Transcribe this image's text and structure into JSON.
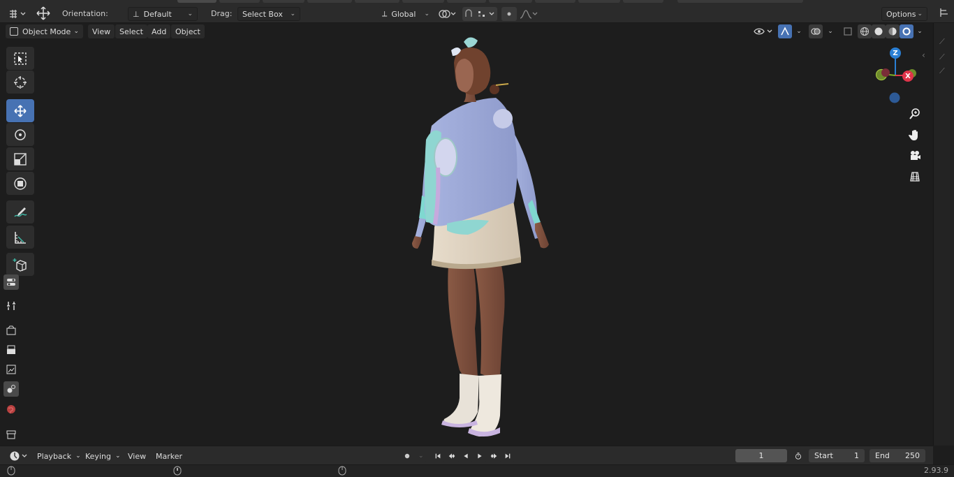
{
  "top": {
    "orientation_label": "Orientation:",
    "orientation_value": "Default",
    "drag_label": "Drag:",
    "drag_value": "Select Box",
    "transform_space": "Global",
    "options_label": "Options"
  },
  "header": {
    "mode": "Object Mode",
    "menus": [
      "View",
      "Select",
      "Add",
      "Object"
    ]
  },
  "gizmo": {
    "z_label": "Z",
    "x_label": "X",
    "y_label": "Y"
  },
  "timeline": {
    "menus": [
      "Playback",
      "Keying",
      "View",
      "Marker"
    ],
    "current_frame": "1",
    "start_label": "Start",
    "start_value": "1",
    "end_label": "End",
    "end_value": "250"
  },
  "status": {
    "version": "2.93.9"
  },
  "colors": {
    "accent": "#4772b3",
    "axis_x": "#e0344a",
    "axis_y": "#7fb127",
    "axis_z": "#2a7fd4"
  }
}
